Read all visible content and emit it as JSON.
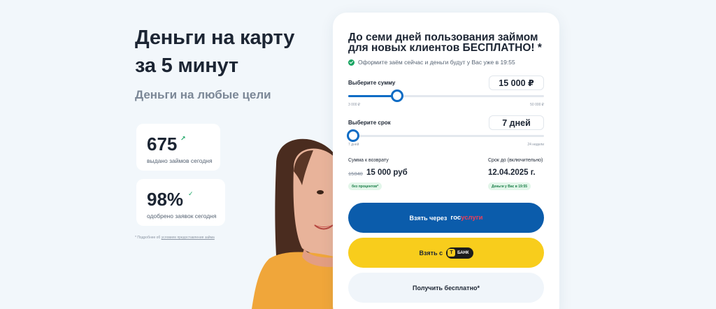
{
  "hero": {
    "title_line1": "Деньги на карту",
    "title_line2": "за 5 минут",
    "subtitle": "Деньги на любые цели"
  },
  "stats": [
    {
      "value": "675",
      "mark": "↗",
      "label": "выдано займов сегодня"
    },
    {
      "value": "98%",
      "mark": "✓",
      "label": "одобрено заявок сегодня"
    }
  ],
  "footnote": {
    "prefix": "* Подробнее об",
    "link": "условиях предоставления займа"
  },
  "form": {
    "title": "До семи дней пользования займом для новых клиентов БЕСПЛАТНО! *",
    "notice": "Оформите заём сейчас и деньги будут у Вас уже в   19:55",
    "amount": {
      "label": "Выберите сумму",
      "value": "15 000 ₽",
      "min": "3 000 ₽",
      "max": "50 000 ₽",
      "position": 0.25
    },
    "term": {
      "label": "Выберите срок",
      "value": "7 дней",
      "min": "7 дней",
      "max": "24 недели",
      "position": 0.0
    },
    "repay": {
      "label": "Сумма к возврату",
      "old": "15840",
      "new": "15 000 руб",
      "badge": "без процентов*"
    },
    "due": {
      "label": "Срок до (включительно)",
      "date": "12.04.2025 г.",
      "badge": "Деньги у Вас в 19:55"
    },
    "buttons": {
      "gosuslugi_prefix": "Взять через",
      "gosuslugi_logo_a": "гос",
      "gosuslugi_logo_b": "услуги",
      "tbank_prefix": "Взять с",
      "tbank_logo": "БАНК",
      "tbank_mark": "T",
      "free": "Получить бесплатно*"
    }
  },
  "colors": {
    "accent": "#0e6cc5",
    "gos": "#0b5cab",
    "yellow": "#f8cd1c",
    "green": "#1aa563"
  }
}
